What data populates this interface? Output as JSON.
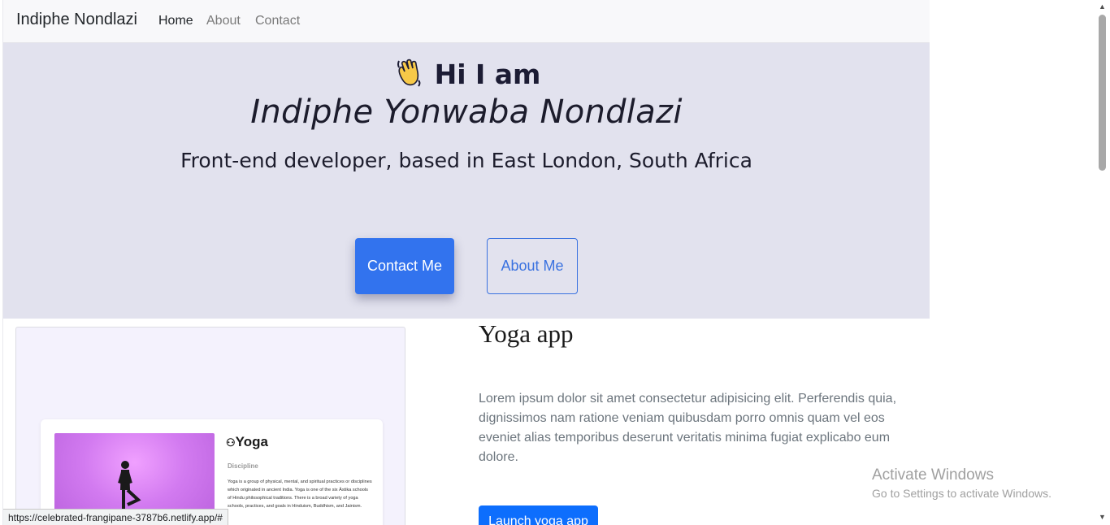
{
  "navbar": {
    "brand": "Indiphe Nondlazi",
    "links": [
      {
        "label": "Home",
        "active": true
      },
      {
        "label": "About",
        "active": false
      },
      {
        "label": "Contact",
        "active": false
      }
    ]
  },
  "hero": {
    "greeting_icon": "waving-hand-icon",
    "greeting": "Hi I am",
    "name": "Indiphe Yonwaba Nondlazi",
    "subtitle": "Front-end developer, based in East London, South Africa",
    "contact_button": "Contact Me",
    "about_button": "About Me",
    "colors": {
      "background": "#e2e2ee",
      "primary": "#3273ee"
    }
  },
  "project": {
    "title": "Yoga app",
    "description": "Lorem ipsum dolor sit amet consectetur adipisicing elit. Perferendis quia, dignissimos nam ratione veniam quibusdam porro omnis quam vel eos eveniet alias temporibus deserunt veritatis minima fugiat explicabo eum dolore.",
    "launch_button": "Launch yoga app",
    "preview": {
      "icon": "meditation-icon",
      "title": "Yoga",
      "label": "Discipline",
      "text": "Yoga is a group of physical, mental, and spiritual practices or disciplines which originated in ancient India. Yoga is one of the six Āstika schools of Hindu philosophical traditions. There is a broad variety of yoga schools, practices, and goals in Hinduism, Buddhism, and Jainism."
    }
  },
  "watermark": {
    "title": "Activate Windows",
    "subtitle": "Go to Settings to activate Windows."
  },
  "status_bar": {
    "url": "https://celebrated-frangipane-3787b6.netlify.app/#"
  }
}
